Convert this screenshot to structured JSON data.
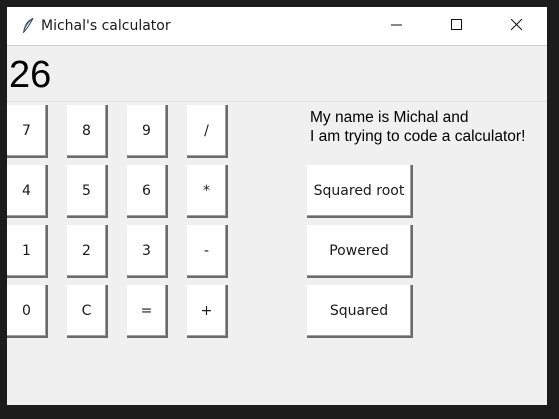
{
  "window": {
    "title": "Michal's calculator",
    "icon": "feather-icon",
    "controls": [
      "minimize-icon",
      "maximize-icon",
      "close-icon"
    ]
  },
  "display": {
    "value": "26"
  },
  "keypad": {
    "rows": [
      [
        "7",
        "8",
        "9",
        "/"
      ],
      [
        "4",
        "5",
        "6",
        "*"
      ],
      [
        "1",
        "2",
        "3",
        "-"
      ],
      [
        "0",
        "C",
        "=",
        "+"
      ]
    ]
  },
  "message": {
    "line1": "My name is Michal and",
    "line2": "I am trying to code a calculator!"
  },
  "functions": {
    "squared_root": "Squared root",
    "powered": "Powered",
    "squared": "Squared"
  },
  "colors": {
    "window_bg": "#f0f0f0",
    "titlebar_bg": "#ffffff",
    "button_bg": "#ffffff",
    "outer_bg": "#1c1c1c"
  }
}
